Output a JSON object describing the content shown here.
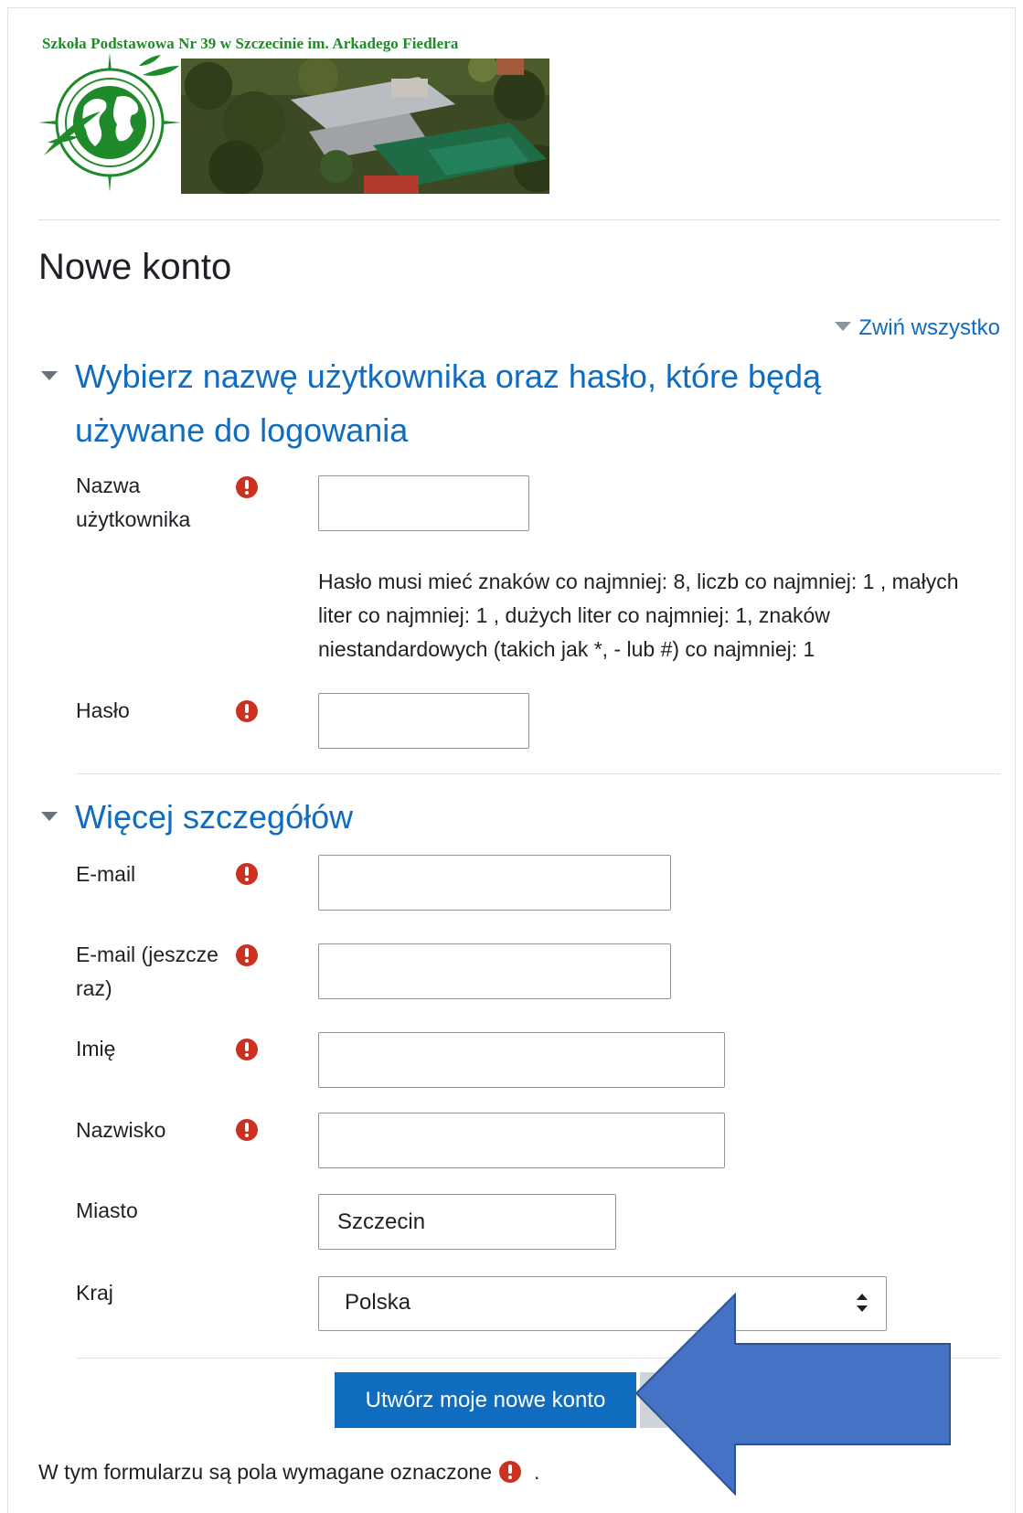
{
  "header": {
    "school_name": "Szkoła Podstawowa Nr 39 w Szczecinie im. Arkadego Fiedlera"
  },
  "page": {
    "title": "Nowe konto",
    "collapse_all": "Zwiń wszystko"
  },
  "section_account": {
    "title": "Wybierz nazwę użytkownika oraz hasło, które będą używane do logowania",
    "username_label": "Nazwa użytkownika",
    "username_value": "",
    "password_help": "Hasło musi mieć znaków co najmniej: 8, liczb co najmniej: 1 , małych liter co najmniej: 1 , dużych liter co najmniej: 1, znaków niestandardowych (takich jak *, - lub #) co najmniej: 1",
    "password_label": "Hasło",
    "password_value": ""
  },
  "section_details": {
    "title": "Więcej szczegółów",
    "email_label": "E-mail",
    "email_value": "",
    "email_again_label": "E-mail (jeszcze raz)",
    "email_again_value": "",
    "firstname_label": "Imię",
    "firstname_value": "",
    "lastname_label": "Nazwisko",
    "lastname_value": "",
    "city_label": "Miasto",
    "city_value": "Szczecin",
    "country_label": "Kraj",
    "country_value": "Polska"
  },
  "actions": {
    "submit_label": "Utwórz moje nowe konto"
  },
  "footer": {
    "required_note": "W tym formularzu są pola wymagane oznaczone",
    "required_note_end": "."
  },
  "colors": {
    "accent": "#0f6cbf",
    "required": "#ca3120",
    "annotation_arrow": "#4472c4",
    "logo_green": "#1f8a2a"
  },
  "icons": {
    "required": "exclamation-circle-icon",
    "section_toggle": "caret-down-icon",
    "select": "sort-arrows-icon",
    "annotation": "left-arrow-icon"
  }
}
